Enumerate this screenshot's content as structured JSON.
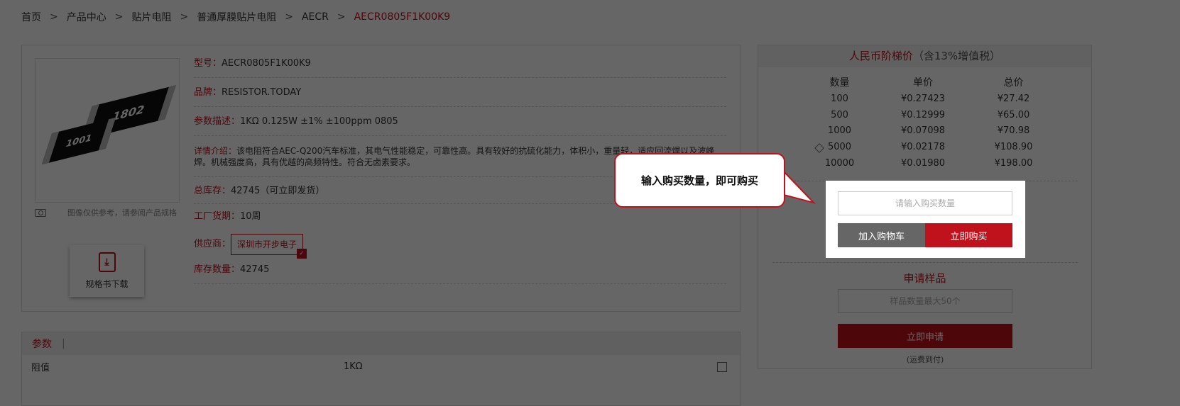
{
  "breadcrumb": {
    "items": [
      "首页",
      "产品中心",
      "贴片电阻",
      "普通厚膜贴片电阻",
      "AECR"
    ],
    "current": "AECR0805F1K00K9",
    "separator": ">"
  },
  "product": {
    "image_labels": [
      "1802",
      "1001"
    ],
    "image_note": "图像仅供参考，请参阅产品规格",
    "datasheet_label": "规格书下载",
    "fields": {
      "model_label": "型号：",
      "model_value": "AECR0805F1K00K9",
      "brand_label": "品牌：",
      "brand_value": "RESISTOR.TODAY",
      "param_label": "参数描述：",
      "param_value": "1KΩ 0.125W ±1% ±100ppm 0805",
      "detail_label": "详情介绍：",
      "detail_value": "该电阻符合AEC-Q200汽车标准，其电气性能稳定，可靠性高。具有较好的抗硫化能力，体积小，重量轻，适应回流焊以及波峰焊。机械强度高，具有优越的高频特性。符合无卤素要求。",
      "stock_label": "总库存：",
      "stock_value": "42745（可立即发货）",
      "leadtime_label": "工厂货期：",
      "leadtime_value": "10周",
      "supplier_label": "供应商：",
      "supplier_value": "深圳市开步电子",
      "qty_label": "库存数量：",
      "qty_value": "42745"
    }
  },
  "params": {
    "tab_label": "参数",
    "pipe": "|",
    "rows": [
      {
        "name": "阻值",
        "value": "1KΩ"
      }
    ]
  },
  "pricing": {
    "title_rmb": "人民币阶梯价",
    "title_tax": "（含13%增值税）",
    "headers": [
      "数量",
      "单价",
      "总价"
    ],
    "rows": [
      {
        "qty": "100",
        "unit": "¥0.27423",
        "total": "¥27.42"
      },
      {
        "qty": "500",
        "unit": "¥0.12999",
        "total": "¥65.00"
      },
      {
        "qty": "1000",
        "unit": "¥0.07098",
        "total": "¥70.98"
      },
      {
        "qty": "5000",
        "unit": "¥0.02178",
        "total": "¥108.90"
      },
      {
        "qty": "10000",
        "unit": "¥0.01980",
        "total": "¥198.00"
      }
    ],
    "qty_placeholder": "请输入购买数量",
    "add_cart_label": "加入购物车",
    "buy_now_label": "立即购买"
  },
  "sample": {
    "title": "申请样品",
    "placeholder": "样品数量最大50个",
    "apply_label": "立即申请",
    "freight_note": "(运费到付)"
  },
  "tooltip": {
    "text": "输入购买数量，即可购买"
  },
  "colors": {
    "accent": "#c0121c",
    "overlay": "rgba(0,0,0,0.6)"
  }
}
